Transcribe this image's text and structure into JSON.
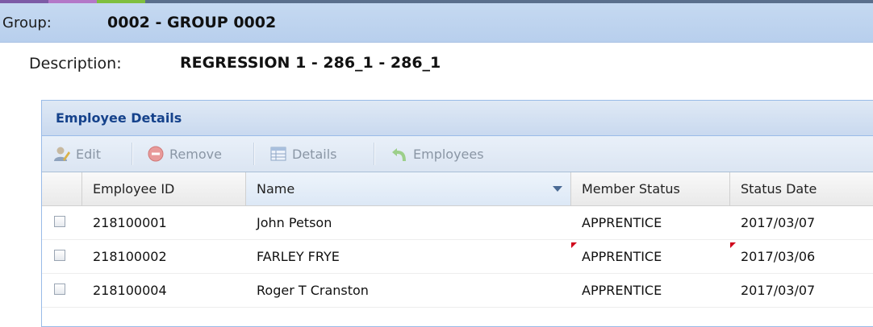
{
  "group": {
    "label": "Group:",
    "value": "0002 - GROUP 0002"
  },
  "description": {
    "label": "Description:",
    "value": "REGRESSION 1 - 286_1 - 286_1"
  },
  "panel": {
    "title": "Employee Details"
  },
  "toolbar": {
    "edit": "Edit",
    "remove": "Remove",
    "details": "Details",
    "employees": "Employees"
  },
  "grid": {
    "columns": [
      "Employee ID",
      "Name",
      "Member Status",
      "Status Date"
    ],
    "sorted_column": "Name",
    "rows": [
      {
        "id": "218100001",
        "name": "John Petson",
        "status": "APPRENTICE",
        "date": "2017/03/07",
        "dirty_status": false,
        "dirty_date": false
      },
      {
        "id": "218100002",
        "name": "FARLEY FRYE",
        "status": "APPRENTICE",
        "date": "2017/03/06",
        "dirty_status": true,
        "dirty_date": true
      },
      {
        "id": "218100004",
        "name": "Roger T Cranston",
        "status": "APPRENTICE",
        "date": "2017/03/07",
        "dirty_status": false,
        "dirty_date": false
      }
    ]
  },
  "colors": {
    "accent": "#15428b",
    "header_bg": "#c5d9f1",
    "dirty_marker": "#d0021b"
  }
}
